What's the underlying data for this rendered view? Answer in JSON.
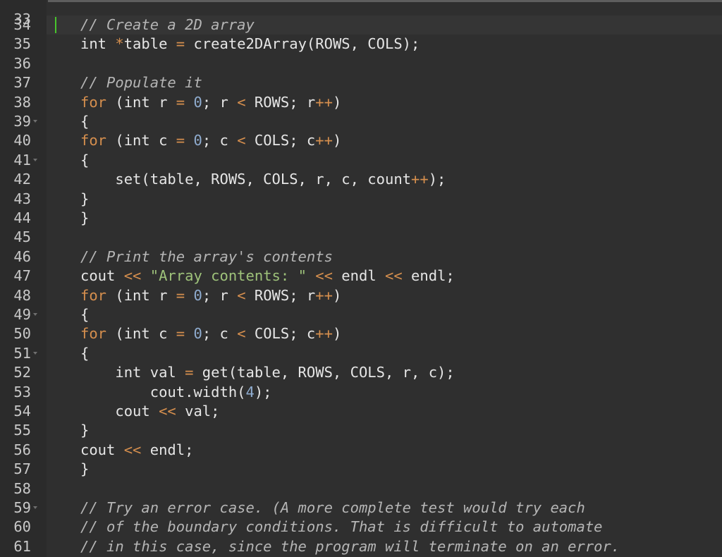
{
  "colors": {
    "background": "#2f2f2f",
    "gutter": "#2b2b2b",
    "line_number": "#c8c8c8",
    "keyword": "#d68f4e",
    "number": "#8faccf",
    "string": "#9ec27a",
    "comment": "#b5b5b5",
    "text": "#e6e6e6",
    "cursor": "#48c52c"
  },
  "partial_top_line_number": "33",
  "lines": [
    {
      "number": "34",
      "fold": false,
      "tokens": [
        {
          "t": "// Create a 2D array",
          "k": "cm"
        }
      ]
    },
    {
      "number": "35",
      "fold": false,
      "tokens": [
        {
          "t": "int ",
          "k": "plain"
        },
        {
          "t": "*",
          "k": "op"
        },
        {
          "t": "table ",
          "k": "plain"
        },
        {
          "t": "=",
          "k": "op"
        },
        {
          "t": " create2DArray(ROWS, COLS);",
          "k": "plain"
        }
      ]
    },
    {
      "number": "36",
      "fold": false,
      "tokens": []
    },
    {
      "number": "37",
      "fold": false,
      "tokens": [
        {
          "t": "// Populate it",
          "k": "cm"
        }
      ]
    },
    {
      "number": "38",
      "fold": false,
      "tokens": [
        {
          "t": "for",
          "k": "kw"
        },
        {
          "t": " (int r ",
          "k": "plain"
        },
        {
          "t": "=",
          "k": "op"
        },
        {
          "t": " ",
          "k": "plain"
        },
        {
          "t": "0",
          "k": "num"
        },
        {
          "t": "; r ",
          "k": "plain"
        },
        {
          "t": "<",
          "k": "op"
        },
        {
          "t": " ROWS; r",
          "k": "plain"
        },
        {
          "t": "++",
          "k": "op"
        },
        {
          "t": ")",
          "k": "plain"
        }
      ]
    },
    {
      "number": "39",
      "fold": true,
      "tokens": [
        {
          "t": "{",
          "k": "plain"
        }
      ]
    },
    {
      "number": "40",
      "fold": false,
      "tokens": [
        {
          "t": "for",
          "k": "kw"
        },
        {
          "t": " (int c ",
          "k": "plain"
        },
        {
          "t": "=",
          "k": "op"
        },
        {
          "t": " ",
          "k": "plain"
        },
        {
          "t": "0",
          "k": "num"
        },
        {
          "t": "; c ",
          "k": "plain"
        },
        {
          "t": "<",
          "k": "op"
        },
        {
          "t": " COLS; c",
          "k": "plain"
        },
        {
          "t": "++",
          "k": "op"
        },
        {
          "t": ")",
          "k": "plain"
        }
      ]
    },
    {
      "number": "41",
      "fold": true,
      "tokens": [
        {
          "t": "{",
          "k": "plain"
        }
      ]
    },
    {
      "number": "42",
      "fold": false,
      "tokens": [
        {
          "t": "    set(table, ROWS, COLS, r, c, count",
          "k": "plain"
        },
        {
          "t": "++",
          "k": "op"
        },
        {
          "t": ");",
          "k": "plain"
        }
      ]
    },
    {
      "number": "43",
      "fold": false,
      "tokens": [
        {
          "t": "}",
          "k": "plain"
        }
      ]
    },
    {
      "number": "44",
      "fold": false,
      "tokens": [
        {
          "t": "}",
          "k": "plain"
        }
      ]
    },
    {
      "number": "45",
      "fold": false,
      "tokens": []
    },
    {
      "number": "46",
      "fold": false,
      "tokens": [
        {
          "t": "// Print the array's contents",
          "k": "cm"
        }
      ]
    },
    {
      "number": "47",
      "fold": false,
      "tokens": [
        {
          "t": "cout ",
          "k": "plain"
        },
        {
          "t": "<<",
          "k": "op"
        },
        {
          "t": " ",
          "k": "plain"
        },
        {
          "t": "\"Array contents: \"",
          "k": "str"
        },
        {
          "t": " ",
          "k": "plain"
        },
        {
          "t": "<<",
          "k": "op"
        },
        {
          "t": " endl ",
          "k": "plain"
        },
        {
          "t": "<<",
          "k": "op"
        },
        {
          "t": " endl;",
          "k": "plain"
        }
      ]
    },
    {
      "number": "48",
      "fold": false,
      "tokens": [
        {
          "t": "for",
          "k": "kw"
        },
        {
          "t": " (int r ",
          "k": "plain"
        },
        {
          "t": "=",
          "k": "op"
        },
        {
          "t": " ",
          "k": "plain"
        },
        {
          "t": "0",
          "k": "num"
        },
        {
          "t": "; r ",
          "k": "plain"
        },
        {
          "t": "<",
          "k": "op"
        },
        {
          "t": " ROWS; r",
          "k": "plain"
        },
        {
          "t": "++",
          "k": "op"
        },
        {
          "t": ")",
          "k": "plain"
        }
      ]
    },
    {
      "number": "49",
      "fold": true,
      "tokens": [
        {
          "t": "{",
          "k": "plain"
        }
      ]
    },
    {
      "number": "50",
      "fold": false,
      "tokens": [
        {
          "t": "for",
          "k": "kw"
        },
        {
          "t": " (int c ",
          "k": "plain"
        },
        {
          "t": "=",
          "k": "op"
        },
        {
          "t": " ",
          "k": "plain"
        },
        {
          "t": "0",
          "k": "num"
        },
        {
          "t": "; c ",
          "k": "plain"
        },
        {
          "t": "<",
          "k": "op"
        },
        {
          "t": " COLS; c",
          "k": "plain"
        },
        {
          "t": "++",
          "k": "op"
        },
        {
          "t": ")",
          "k": "plain"
        }
      ]
    },
    {
      "number": "51",
      "fold": true,
      "tokens": [
        {
          "t": "{",
          "k": "plain"
        }
      ]
    },
    {
      "number": "52",
      "fold": false,
      "tokens": [
        {
          "t": "    int val ",
          "k": "plain"
        },
        {
          "t": "=",
          "k": "op"
        },
        {
          "t": " get(table, ROWS, COLS, r, c);",
          "k": "plain"
        }
      ]
    },
    {
      "number": "53",
      "fold": false,
      "tokens": [
        {
          "t": "        cout.width(",
          "k": "plain"
        },
        {
          "t": "4",
          "k": "num"
        },
        {
          "t": ");",
          "k": "plain"
        }
      ]
    },
    {
      "number": "54",
      "fold": false,
      "tokens": [
        {
          "t": "    cout ",
          "k": "plain"
        },
        {
          "t": "<<",
          "k": "op"
        },
        {
          "t": " val;",
          "k": "plain"
        }
      ]
    },
    {
      "number": "55",
      "fold": false,
      "tokens": [
        {
          "t": "}",
          "k": "plain"
        }
      ]
    },
    {
      "number": "56",
      "fold": false,
      "tokens": [
        {
          "t": "cout ",
          "k": "plain"
        },
        {
          "t": "<<",
          "k": "op"
        },
        {
          "t": " endl;",
          "k": "plain"
        }
      ]
    },
    {
      "number": "57",
      "fold": false,
      "tokens": [
        {
          "t": "}",
          "k": "plain"
        }
      ]
    },
    {
      "number": "58",
      "fold": false,
      "tokens": []
    },
    {
      "number": "59",
      "fold": true,
      "tokens": [
        {
          "t": "// Try an error case. (A more complete test would try each",
          "k": "cm"
        }
      ]
    },
    {
      "number": "60",
      "fold": false,
      "tokens": [
        {
          "t": "// of the boundary conditions. That is difficult to automate",
          "k": "cm"
        }
      ]
    },
    {
      "number": "61",
      "fold": false,
      "tokens": [
        {
          "t": "// in this case, since the program will terminate on an error.",
          "k": "cm"
        }
      ]
    }
  ]
}
